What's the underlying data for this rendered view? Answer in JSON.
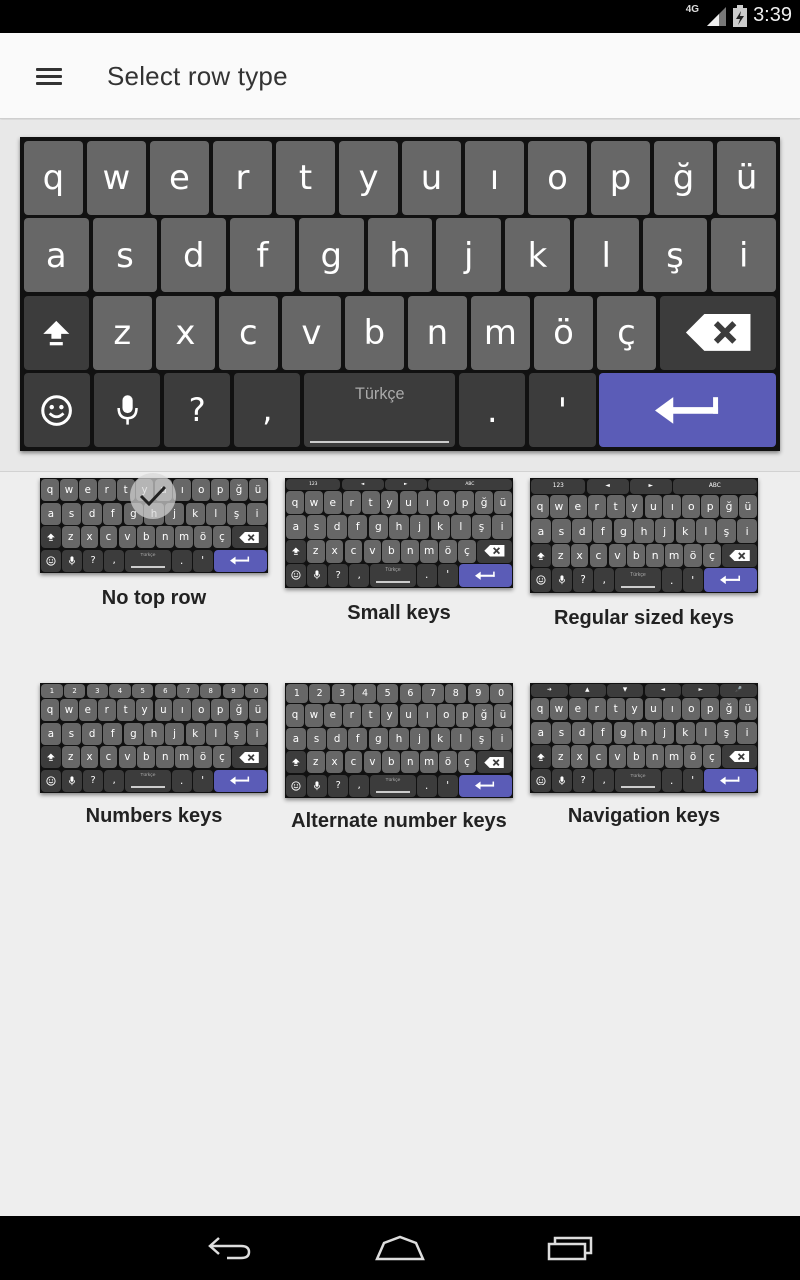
{
  "status_bar": {
    "network": "4G",
    "time": "3:39"
  },
  "app_bar": {
    "title": "Select row type"
  },
  "keyboard": {
    "row1": [
      "q",
      "w",
      "e",
      "r",
      "t",
      "y",
      "u",
      "ı",
      "o",
      "p",
      "ğ",
      "ü"
    ],
    "row2": [
      "a",
      "s",
      "d",
      "f",
      "g",
      "h",
      "j",
      "k",
      "l",
      "ş",
      "i"
    ],
    "row3": [
      "z",
      "x",
      "c",
      "v",
      "b",
      "n",
      "m",
      "ö",
      "ç"
    ],
    "row4_keys": [
      "?",
      ",",
      ".",
      "'"
    ],
    "space_label": "Türkçe"
  },
  "top_rows": {
    "numbers": [
      "1",
      "2",
      "3",
      "4",
      "5",
      "6",
      "7",
      "8",
      "9",
      "0"
    ],
    "small": [
      "123",
      "◄",
      "►",
      "ABC"
    ],
    "navigation": [
      "➔",
      "▲",
      "▼",
      "◄",
      "►",
      "🎤"
    ]
  },
  "options": [
    {
      "id": "no-top-row",
      "label": "No top row",
      "selected": true
    },
    {
      "id": "small-keys",
      "label": "Small keys",
      "selected": false
    },
    {
      "id": "regular-sized-keys",
      "label": "Regular sized keys",
      "selected": false
    },
    {
      "id": "numbers-keys",
      "label": "Numbers keys",
      "selected": false
    },
    {
      "id": "alternate-number-keys",
      "label": "Alternate number keys",
      "selected": false
    },
    {
      "id": "navigation-keys",
      "label": "Navigation keys",
      "selected": false
    }
  ],
  "colors": {
    "key_light": "#676767",
    "key_dark": "#3c3c3c",
    "enter": "#5b5cb7",
    "keyboard_bg": "#111111"
  },
  "icons": {
    "status": [
      "signal-icon",
      "battery-icon"
    ],
    "app_bar": [
      "menu-icon"
    ],
    "keyboard": [
      "shift-icon",
      "backspace-icon",
      "emoji-icon",
      "mic-icon",
      "enter-icon"
    ],
    "nav": [
      "back-icon",
      "home-icon",
      "recents-icon"
    ]
  }
}
